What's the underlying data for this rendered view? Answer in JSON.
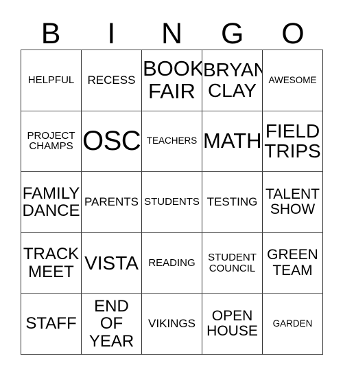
{
  "card": {
    "title_letters": [
      "B",
      "I",
      "N",
      "G",
      "O"
    ],
    "rows": [
      [
        {
          "text": "HELPFUL",
          "size": "fs-xxs"
        },
        {
          "text": "RECESS",
          "size": "fs-xs"
        },
        {
          "text": "BOOK\nFAIR",
          "size": "fs-xl"
        },
        {
          "text": "BRYAN\nCLAY",
          "size": "fs-lg"
        },
        {
          "text": "AWESOME",
          "size": "fs-tiny"
        }
      ],
      [
        {
          "text": "PROJECT\nCHAMPS",
          "size": "fs-xxs"
        },
        {
          "text": "OSC",
          "size": "fs-xxl"
        },
        {
          "text": "TEACHERS",
          "size": "fs-tiny"
        },
        {
          "text": "MATH",
          "size": "fs-xl"
        },
        {
          "text": "FIELD\nTRIPS",
          "size": "fs-lg"
        }
      ],
      [
        {
          "text": "FAMILY\nDANCE",
          "size": "fs-md"
        },
        {
          "text": "PARENTS",
          "size": "fs-xs"
        },
        {
          "text": "STUDENTS",
          "size": "fs-xxs"
        },
        {
          "text": "TESTING",
          "size": "fs-xs"
        },
        {
          "text": "TALENT\nSHOW",
          "size": "fs-sm"
        }
      ],
      [
        {
          "text": "TRACK\nMEET",
          "size": "fs-md"
        },
        {
          "text": "VISTA",
          "size": "fs-lg"
        },
        {
          "text": "READING",
          "size": "fs-xxs"
        },
        {
          "text": "STUDENT\nCOUNCIL",
          "size": "fs-xxs"
        },
        {
          "text": "GREEN\nTEAM",
          "size": "fs-sm"
        }
      ],
      [
        {
          "text": "STAFF",
          "size": "fs-md"
        },
        {
          "text": "END\nOF\nYEAR",
          "size": "fs-md"
        },
        {
          "text": "VIKINGS",
          "size": "fs-xs"
        },
        {
          "text": "OPEN\nHOUSE",
          "size": "fs-sm"
        },
        {
          "text": "GARDEN",
          "size": "fs-tiny"
        }
      ]
    ]
  },
  "colors": {
    "background": "#ffffff",
    "text": "#000000",
    "grid_line": "#333333"
  }
}
